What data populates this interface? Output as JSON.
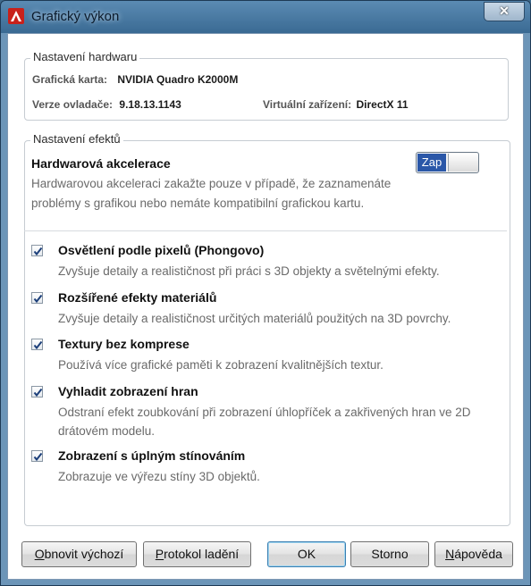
{
  "window": {
    "title": "Grafický výkon",
    "close_label": "✕"
  },
  "hardware": {
    "group_title": "Nastavení hardwaru",
    "graphics_card_label": "Grafická karta:",
    "graphics_card_value": "NVIDIA Quadro K2000M",
    "driver_label": "Verze ovladače:",
    "driver_value": "9.18.13.1143",
    "virtual_device_label": "Virtuální zařízení:",
    "virtual_device_value": "DirectX 11"
  },
  "effects": {
    "group_title": "Nastavení efektů",
    "acceleration_title": "Hardwarová akcelerace",
    "acceleration_desc": "Hardwarovou akceleraci zakažte pouze v případě, že zaznamenáte problémy s grafikou nebo nemáte kompatibilní grafickou kartu.",
    "toggle_label": "Zap",
    "options": [
      {
        "label": "Osvětlení podle pixelů (Phongovo)",
        "desc": "Zvyšuje detaily a realističnost při práci s 3D objekty a světelnými efekty.",
        "checked": true
      },
      {
        "label": "Rozšířené efekty materiálů",
        "desc": "Zvyšuje detaily a realističnost určitých materiálů použitých na 3D povrchy.",
        "checked": true
      },
      {
        "label": "Textury bez komprese",
        "desc": "Používá více grafické paměti k zobrazení kvalitnějších textur.",
        "checked": true
      },
      {
        "label": "Vyhladit zobrazení hran",
        "desc": "Odstraní efekt zoubkování při zobrazení úhlopříček a zakřivených hran ve 2D drátovém modelu.",
        "checked": true
      },
      {
        "label": "Zobrazení s úplným stínováním",
        "desc": "Zobrazuje ve výřezu stíny 3D objektů.",
        "checked": true
      }
    ]
  },
  "buttons": {
    "reset_first": "O",
    "reset_rest": "bnovit výchozí",
    "debug_first": "P",
    "debug_rest": "rotokol ladění",
    "ok": "OK",
    "cancel": "Storno",
    "help_first": "N",
    "help_rest": "ápověda"
  },
  "colors": {
    "toggle_on": "#2a57a8",
    "title_bar": "#3a6a93",
    "app_icon": "#c8211b"
  }
}
